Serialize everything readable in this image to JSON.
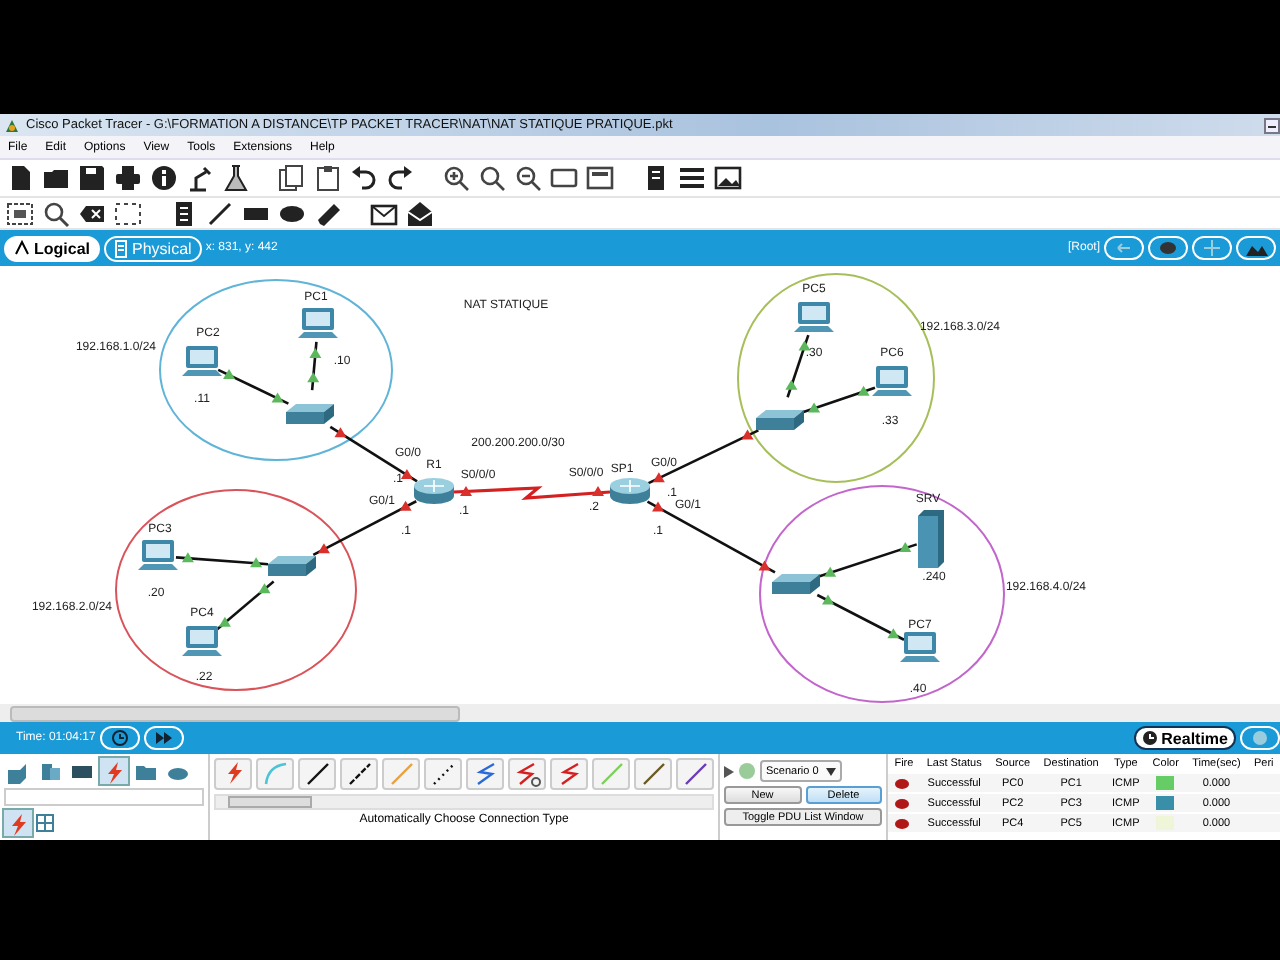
{
  "window": {
    "title": "Cisco Packet Tracer - G:\\FORMATION A DISTANCE\\TP PACKET TRACER\\NAT\\NAT STATIQUE PRATIQUE.pkt"
  },
  "menu": [
    "File",
    "Edit",
    "Options",
    "View",
    "Tools",
    "Extensions",
    "Help"
  ],
  "workspace_tabs": [
    {
      "label": "Logical",
      "selected": true
    },
    {
      "label": "Physical",
      "selected": false
    }
  ],
  "cursor_position": "x: 831, y: 442",
  "breadcrumb": "[Root]",
  "canvas": {
    "title": "NAT STATIQUE",
    "wan_label": "200.200.200.0/30",
    "networks": [
      {
        "label": "192.168.1.0/24",
        "color": "#5fb4d8"
      },
      {
        "label": "192.168.2.0/24",
        "color": "#d9545a"
      },
      {
        "label": "192.168.3.0/24",
        "color": "#a6bf5a"
      },
      {
        "label": "192.168.4.0/24",
        "color": "#c266cc"
      }
    ],
    "devices": [
      {
        "kind": "pc",
        "name": "PC1",
        "address": ".10"
      },
      {
        "kind": "pc",
        "name": "PC2",
        "address": ".11"
      },
      {
        "kind": "switch"
      },
      {
        "kind": "router",
        "name": "R1"
      },
      {
        "kind": "switch"
      },
      {
        "kind": "pc",
        "name": "PC3",
        "address": ".20"
      },
      {
        "kind": "pc",
        "name": "PC4",
        "address": ".22"
      },
      {
        "kind": "router",
        "name": "SP1"
      },
      {
        "kind": "switch"
      },
      {
        "kind": "pc",
        "name": "PC5",
        "address": ".30"
      },
      {
        "kind": "pc",
        "name": "PC6",
        "address": ".33"
      },
      {
        "kind": "switch"
      },
      {
        "kind": "server",
        "name": "SRV",
        "address": ".240"
      },
      {
        "kind": "pc",
        "name": "PC7",
        "address": ".40"
      }
    ],
    "links": [
      {
        "kind": "copper",
        "end_a_up": true,
        "end_b_up": true
      },
      {
        "kind": "copper",
        "end_a_up": true,
        "end_b_up": true
      },
      {
        "kind": "copper",
        "end_a_up": false,
        "end_b_up": false
      },
      {
        "kind": "copper",
        "end_a_up": false,
        "end_b_up": false
      },
      {
        "kind": "copper",
        "end_a_up": true,
        "end_b_up": true
      },
      {
        "kind": "copper",
        "end_a_up": true,
        "end_b_up": true
      },
      {
        "kind": "serial",
        "end_a_up": false,
        "end_b_up": false
      },
      {
        "kind": "copper",
        "end_a_up": false,
        "end_b_up": false
      },
      {
        "kind": "copper",
        "end_a_up": true,
        "end_b_up": true
      },
      {
        "kind": "copper",
        "end_a_up": true,
        "end_b_up": true
      },
      {
        "kind": "copper",
        "end_a_up": false,
        "end_b_up": false
      },
      {
        "kind": "copper",
        "end_a_up": true,
        "end_b_up": true
      },
      {
        "kind": "copper",
        "end_a_up": true,
        "end_b_up": true
      }
    ],
    "port_labels": [
      "G0/0",
      ".1",
      "G0/1",
      ".1",
      "S0/0/0",
      ".1",
      "S0/0/0",
      ".2",
      "G0/0",
      ".1",
      "G0/1",
      ".1"
    ]
  },
  "time_bar": {
    "time": "Time: 01:04:17",
    "mode": "Realtime"
  },
  "device_categories": [
    {
      "selected": false
    },
    {
      "selected": false
    },
    {
      "selected": false
    },
    {
      "selected": true
    },
    {
      "selected": false
    },
    {
      "selected": false
    }
  ],
  "connection_hint": "Automatically Choose Connection Type",
  "scenario": {
    "name": "Scenario 0",
    "buttons": [
      "New",
      "Delete"
    ],
    "toggle": "Toggle PDU List Window"
  },
  "pdu_table": {
    "columns": [
      "Fire",
      "Last Status",
      "Source",
      "Destination",
      "Type",
      "Color",
      "Time(sec)",
      "Peri"
    ],
    "rows": [
      {
        "last_status": "Successful",
        "source": "PC0",
        "destination": "PC1",
        "type": "ICMP",
        "color": "#66cc66",
        "time": "0.000"
      },
      {
        "last_status": "Successful",
        "source": "PC2",
        "destination": "PC3",
        "type": "ICMP",
        "color": "#3a8fa8",
        "time": "0.000"
      },
      {
        "last_status": "Successful",
        "source": "PC4",
        "destination": "PC5",
        "type": "ICMP",
        "color": "#eef5d8",
        "time": "0.000"
      }
    ]
  }
}
